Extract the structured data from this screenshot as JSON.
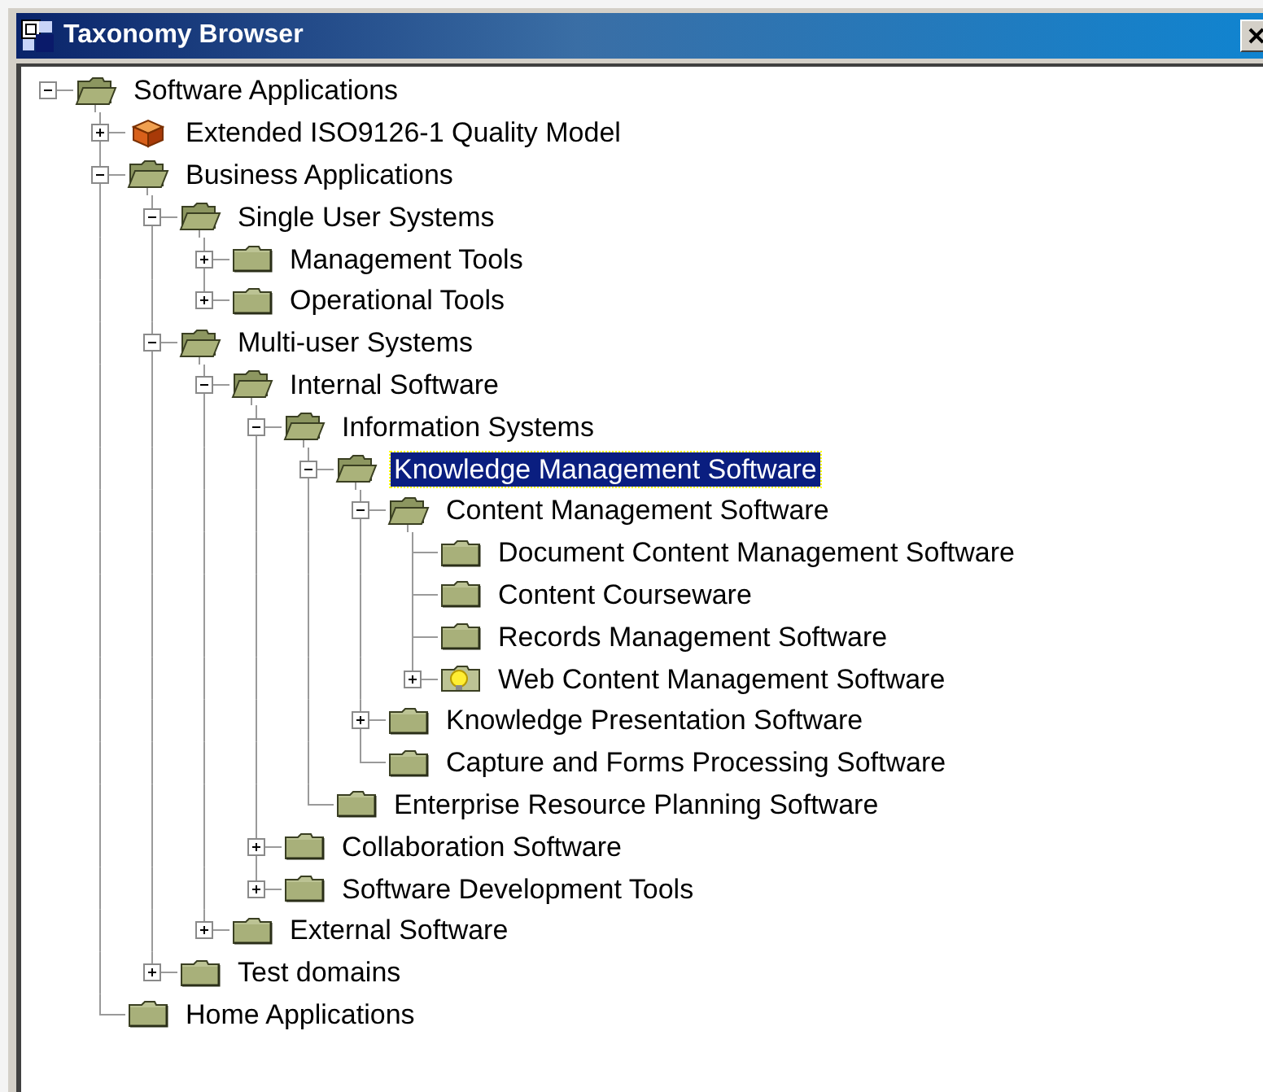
{
  "window": {
    "title": "Taxonomy Browser"
  },
  "tree": [
    {
      "label": "Software Applications",
      "kind": "folder",
      "expanded": true,
      "selected": false,
      "children": [
        {
          "label": "Extended ISO9126-1 Quality Model",
          "kind": "package",
          "expanded": false,
          "selected": false
        },
        {
          "label": "Business Applications",
          "kind": "folder",
          "expanded": true,
          "selected": false,
          "children": [
            {
              "label": "Single User Systems",
              "kind": "folder",
              "expanded": true,
              "selected": false,
              "children": [
                {
                  "label": "Management Tools",
                  "kind": "folder",
                  "expanded": false,
                  "selected": false
                },
                {
                  "label": "Operational Tools",
                  "kind": "folder",
                  "expanded": false,
                  "selected": false
                }
              ]
            },
            {
              "label": "Multi-user Systems",
              "kind": "folder",
              "expanded": true,
              "selected": false,
              "children": [
                {
                  "label": "Internal Software",
                  "kind": "folder",
                  "expanded": true,
                  "selected": false,
                  "children": [
                    {
                      "label": "Information Systems",
                      "kind": "folder",
                      "expanded": true,
                      "selected": false,
                      "children": [
                        {
                          "label": "Knowledge Management Software",
                          "kind": "folder",
                          "expanded": true,
                          "selected": true,
                          "children": [
                            {
                              "label": "Content Management Software",
                              "kind": "folder",
                              "expanded": true,
                              "selected": false,
                              "children": [
                                {
                                  "label": "Document Content Management Software",
                                  "kind": "folder",
                                  "selected": false
                                },
                                {
                                  "label": "Content Courseware",
                                  "kind": "folder",
                                  "selected": false
                                },
                                {
                                  "label": "Records Management Software",
                                  "kind": "folder",
                                  "selected": false
                                },
                                {
                                  "label": "Web Content Management Software",
                                  "kind": "bulb",
                                  "expanded": false,
                                  "selected": false
                                }
                              ]
                            },
                            {
                              "label": "Knowledge Presentation Software",
                              "kind": "folder",
                              "expanded": false,
                              "selected": false
                            },
                            {
                              "label": "Capture and Forms Processing Software",
                              "kind": "folder",
                              "selected": false
                            }
                          ]
                        },
                        {
                          "label": "Enterprise Resource Planning Software",
                          "kind": "folder",
                          "selected": false
                        }
                      ]
                    },
                    {
                      "label": "Collaboration Software",
                      "kind": "folder",
                      "expanded": false,
                      "selected": false
                    },
                    {
                      "label": "Software Development Tools",
                      "kind": "folder",
                      "expanded": false,
                      "selected": false
                    }
                  ]
                },
                {
                  "label": "External Software",
                  "kind": "folder",
                  "expanded": false,
                  "selected": false
                }
              ]
            },
            {
              "label": "Test domains",
              "kind": "folder",
              "expanded": false,
              "selected": false
            }
          ]
        },
        {
          "label": "Home Applications",
          "kind": "folder",
          "selected": false
        }
      ]
    }
  ]
}
